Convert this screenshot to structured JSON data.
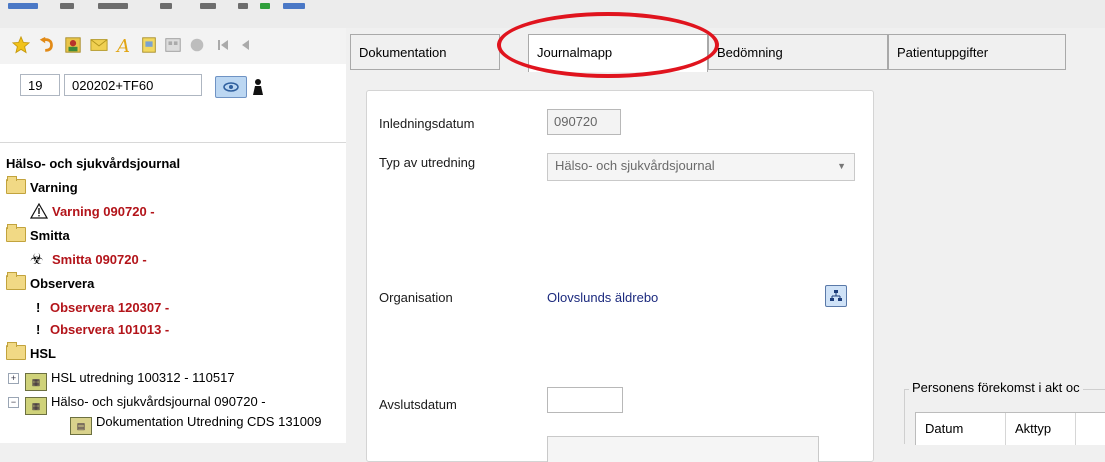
{
  "toolbar": {
    "icons": [
      "star-icon",
      "undo-icon",
      "person-icon",
      "mail-icon",
      "text-style-icon",
      "note-icon",
      "gallery-icon",
      "record-icon",
      "first-icon",
      "prev-icon"
    ]
  },
  "patient": {
    "number": "19",
    "id": "020202+TF60"
  },
  "tree": {
    "root": "Hälso- och sjukvårdsjournal",
    "folders": {
      "varning": "Varning",
      "varning_item": "Varning 090720 -",
      "smitta": "Smitta",
      "smitta_item": "Smitta 090720 -",
      "observera": "Observera",
      "observera_item1": "Observera 120307 -",
      "observera_item2": "Observera 101013 -",
      "hsl": "HSL",
      "hsl_utredning": "HSL utredning 100312 - 110517",
      "hsl_journal": "Hälso- och sjukvårdsjournal 090720 -",
      "dokumentation": "Dokumentation Utredning CDS 131009"
    },
    "marker_bang": "!"
  },
  "tabs": [
    "Dokumentation",
    "Journalmapp",
    "Bedömning",
    "Patientuppgifter"
  ],
  "form": {
    "inledningsdatum_label": "Inledningsdatum",
    "inledningsdatum_value": "090720",
    "typ_label": "Typ av utredning",
    "typ_value": "Hälso- och sjukvårdsjournal",
    "organisation_label": "Organisation",
    "organisation_value": "Olovslunds äldrebo",
    "avslutsdatum_label": "Avslutsdatum",
    "avslutsdatum_value": ""
  },
  "group": {
    "title": "Personens förekomst i akt oc",
    "columns": [
      "Datum",
      "Akttyp"
    ]
  },
  "colors": {
    "highlight": "#e0141e",
    "warning_text": "#b3141a",
    "link_text": "#1c2a7e"
  }
}
